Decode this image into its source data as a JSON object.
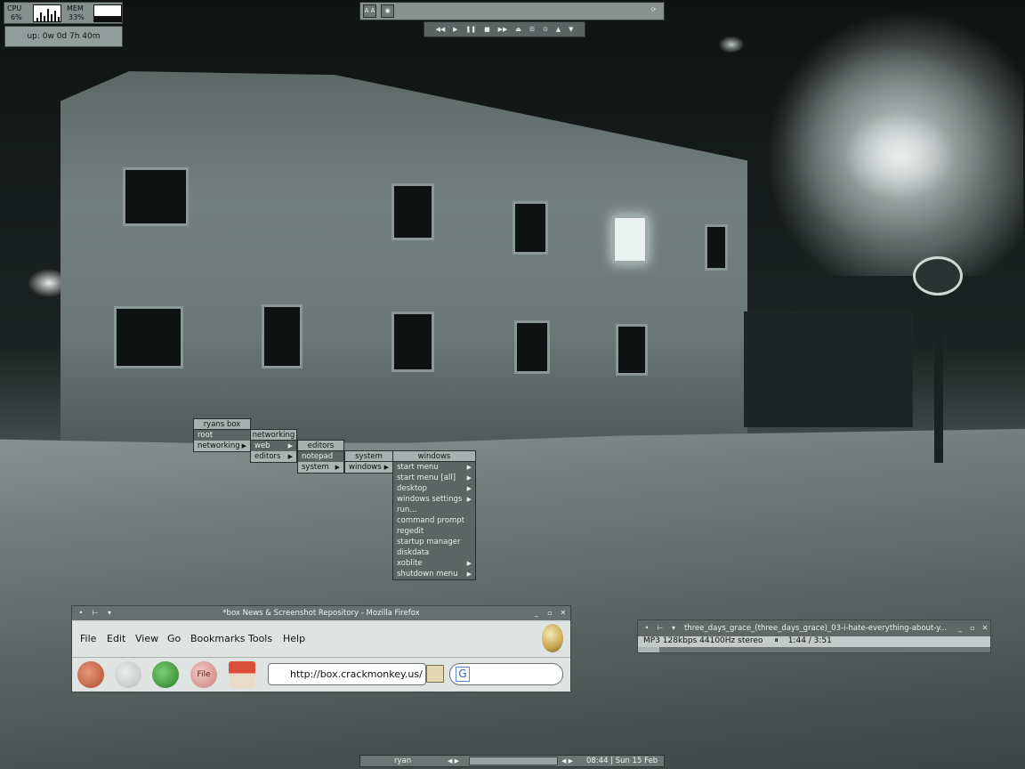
{
  "monitors": {
    "cpu_label": "CPU",
    "cpu_value": "6%",
    "mem_label": "MEM",
    "mem_value": "33%",
    "uptime": "up: 0w 0d 7h 40m"
  },
  "topbar": {
    "left_button": "A A"
  },
  "menus": {
    "root": {
      "title": "ryans box",
      "items": [
        {
          "label": "root",
          "arrow": ""
        },
        {
          "label": "networking",
          "arrow": "▶"
        }
      ]
    },
    "networking": {
      "title": "networking",
      "items": [
        {
          "label": "web",
          "arrow": "▶"
        },
        {
          "label": "editors",
          "arrow": "▶"
        }
      ]
    },
    "editors": {
      "title": "editors",
      "items": [
        {
          "label": "notepad",
          "arrow": ""
        },
        {
          "label": "system",
          "arrow": "▶"
        }
      ]
    },
    "system": {
      "title": "system",
      "items": [
        {
          "label": "windows",
          "arrow": "▶"
        }
      ]
    },
    "windows": {
      "title": "windows",
      "items": [
        {
          "label": "start menu",
          "arrow": "▶"
        },
        {
          "label": "start menu [all]",
          "arrow": "▶"
        },
        {
          "label": "desktop",
          "arrow": "▶"
        },
        {
          "label": "windows settings",
          "arrow": "▶"
        },
        {
          "label": "run...",
          "arrow": ""
        },
        {
          "label": "command prompt",
          "arrow": ""
        },
        {
          "label": "regedit",
          "arrow": ""
        },
        {
          "label": "startup manager",
          "arrow": ""
        },
        {
          "label": "diskdata",
          "arrow": ""
        },
        {
          "label": "xoblite",
          "arrow": "▶"
        },
        {
          "label": "shutdown menu",
          "arrow": "▶"
        }
      ]
    }
  },
  "firefox": {
    "title": "*box News & Screenshot Repository - Mozilla Firefox",
    "menus": [
      "File",
      "Edit",
      "View",
      "Go",
      "Bookmarks",
      "Tools",
      "Help"
    ],
    "url": "http://box.crackmonkey.us/",
    "search_glyph": "G",
    "file_button": "File"
  },
  "xmms": {
    "title": "three_days_grace_(three_days_grace)_03-i-hate-everything-about-y...",
    "info": "MP3 128kbps 44100Hz stereo",
    "time": "1:44 / 3:51"
  },
  "taskbar": {
    "user": "ryan",
    "clock": "08:44 | Sun 15 Feb"
  },
  "colors": {
    "menu_bg": "#5c6564",
    "menu_title": "#a7b0ae",
    "panel": "#89928f"
  }
}
